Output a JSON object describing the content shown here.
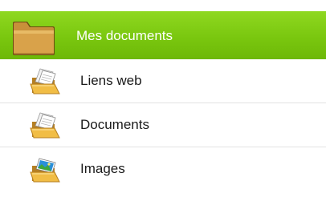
{
  "header": {
    "label": "Mes documents",
    "icon": "folder-icon",
    "background": "#7ac70f",
    "text_color": "#ffffff"
  },
  "items": [
    {
      "label": "Liens web",
      "icon": "open-folder-with-papers-icon"
    },
    {
      "label": "Documents",
      "icon": "open-folder-with-papers-icon"
    },
    {
      "label": "Images",
      "icon": "open-folder-with-pictures-icon"
    }
  ]
}
